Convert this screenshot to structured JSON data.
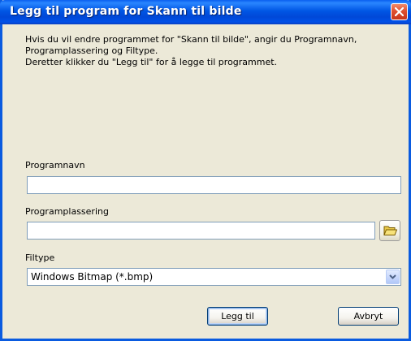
{
  "window": {
    "title": "Legg til program for Skann til bilde"
  },
  "description": {
    "line1": "Hvis du vil endre programmet for \"Skann til bilde\", angir du Programnavn,",
    "line2": "Programplassering og Filtype.",
    "line3": "Deretter klikker du \"Legg til\" for å legge til programmet."
  },
  "form": {
    "program_name_label": "Programnavn",
    "program_name_value": "",
    "program_location_label": "Programplassering",
    "program_location_value": "",
    "filetype_label": "Filtype",
    "filetype_selected": "Windows Bitmap (*.bmp)"
  },
  "buttons": {
    "add": "Legg til",
    "cancel": "Avbryt"
  },
  "icons": {
    "close": "close-icon",
    "browse": "folder-icon",
    "dropdown": "chevron-down-icon"
  },
  "colors": {
    "titlebar": "#0054E3",
    "dialog_bg": "#ECE9D8",
    "close_button": "#E05030"
  }
}
